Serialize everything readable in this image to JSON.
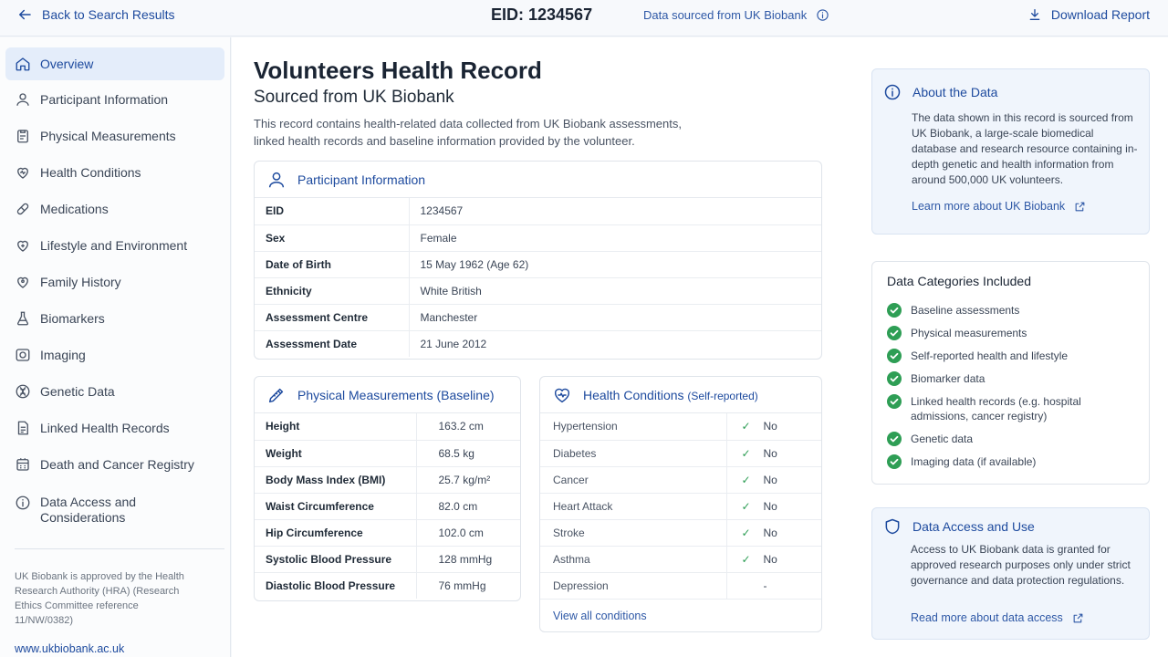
{
  "topbar": {
    "back_label": "Back to Search Results",
    "eid_title": "EID: 1234567",
    "sourced_label": "Data sourced from UK Biobank",
    "download_label": "Download Report"
  },
  "sidebar": {
    "items": [
      {
        "label": "Overview",
        "icon": "home-icon"
      },
      {
        "label": "Participant Information",
        "icon": "user-icon"
      },
      {
        "label": "Physical Measurements",
        "icon": "clipboard-icon"
      },
      {
        "label": "Health Conditions",
        "icon": "heart-icon"
      },
      {
        "label": "Medications",
        "icon": "pill-icon"
      },
      {
        "label": "Lifestyle and Environment",
        "icon": "heart-leaf-icon"
      },
      {
        "label": "Family History",
        "icon": "family-heart-icon"
      },
      {
        "label": "Biomarkers",
        "icon": "flask-icon"
      },
      {
        "label": "Imaging",
        "icon": "camera-icon"
      },
      {
        "label": "Genetic Data",
        "icon": "dna-icon"
      },
      {
        "label": "Linked Health Records",
        "icon": "document-icon"
      },
      {
        "label": "Death and Cancer Registry",
        "icon": "registry-icon"
      },
      {
        "label": "Data Access and Considerations",
        "icon": "info-icon"
      }
    ],
    "note": "UK Biobank is approved by the Health Research Authority (HRA) (Research Ethics Committee reference 11/NW/0382)",
    "link": "www.ukbiobank.ac.uk"
  },
  "main": {
    "title": "Volunteers Health Record",
    "subtitle": "Sourced from UK Biobank",
    "intro": "This record contains health-related data collected from UK Biobank assessments, linked health records and baseline information provided by the volunteer."
  },
  "participant": {
    "title": "Participant Information",
    "rows": [
      {
        "k": "EID",
        "v": "1234567"
      },
      {
        "k": "Sex",
        "v": "Female"
      },
      {
        "k": "Date of Birth",
        "v": "15 May 1962 (Age 62)"
      },
      {
        "k": "Ethnicity",
        "v": "White British"
      },
      {
        "k": "Assessment Centre",
        "v": "Manchester"
      },
      {
        "k": "Assessment Date",
        "v": "21 June 2012"
      }
    ]
  },
  "physical": {
    "title": "Physical Measurements (Baseline)",
    "rows": [
      {
        "k": "Height",
        "v": "163.2 cm"
      },
      {
        "k": "Weight",
        "v": "68.5 kg"
      },
      {
        "k": "Body Mass Index (BMI)",
        "v": "25.7 kg/m²"
      },
      {
        "k": "Waist Circumference",
        "v": "82.0 cm"
      },
      {
        "k": "Hip Circumference",
        "v": "102.0 cm"
      },
      {
        "k": "Systolic Blood Pressure",
        "v": "128 mmHg"
      },
      {
        "k": "Diastolic Blood Pressure",
        "v": "76 mmHg"
      }
    ]
  },
  "conditions": {
    "title": "Health Conditions",
    "title_suffix": "(Self-reported)",
    "rows": [
      {
        "k": "Hypertension",
        "check": "✓",
        "v": "No"
      },
      {
        "k": "Diabetes",
        "check": "✓",
        "v": "No"
      },
      {
        "k": "Cancer",
        "check": "✓",
        "v": "No"
      },
      {
        "k": "Heart Attack",
        "check": "✓",
        "v": "No"
      },
      {
        "k": "Stroke",
        "check": "✓",
        "v": "No"
      },
      {
        "k": "Asthma",
        "check": "✓",
        "v": "No"
      },
      {
        "k": "Depression",
        "check": "",
        "v": "-"
      }
    ],
    "view_all": "View all conditions"
  },
  "about": {
    "title": "About the Data",
    "text": "The data shown in this record is sourced from UK Biobank, a large-scale biomedical database and research resource containing in-depth genetic and health information from around 500,000 UK volunteers.",
    "link": "Learn more about UK Biobank"
  },
  "categories": {
    "title": "Data Categories Included",
    "items": [
      "Baseline assessments",
      "Physical measurements",
      "Self-reported health and lifestyle",
      "Biomarker data",
      "Linked health records (e.g. hospital admissions, cancer registry)",
      "Genetic data",
      "Imaging data (if available)"
    ]
  },
  "access": {
    "title": "Data Access and Use",
    "text": "Access to UK Biobank data is granted for approved research purposes only under strict governance and data protection regulations.",
    "link": "Read more about data access"
  },
  "colors": {
    "accent": "#1d4a9e",
    "active_bg": "#e4edfa",
    "success": "#2e9e55"
  }
}
